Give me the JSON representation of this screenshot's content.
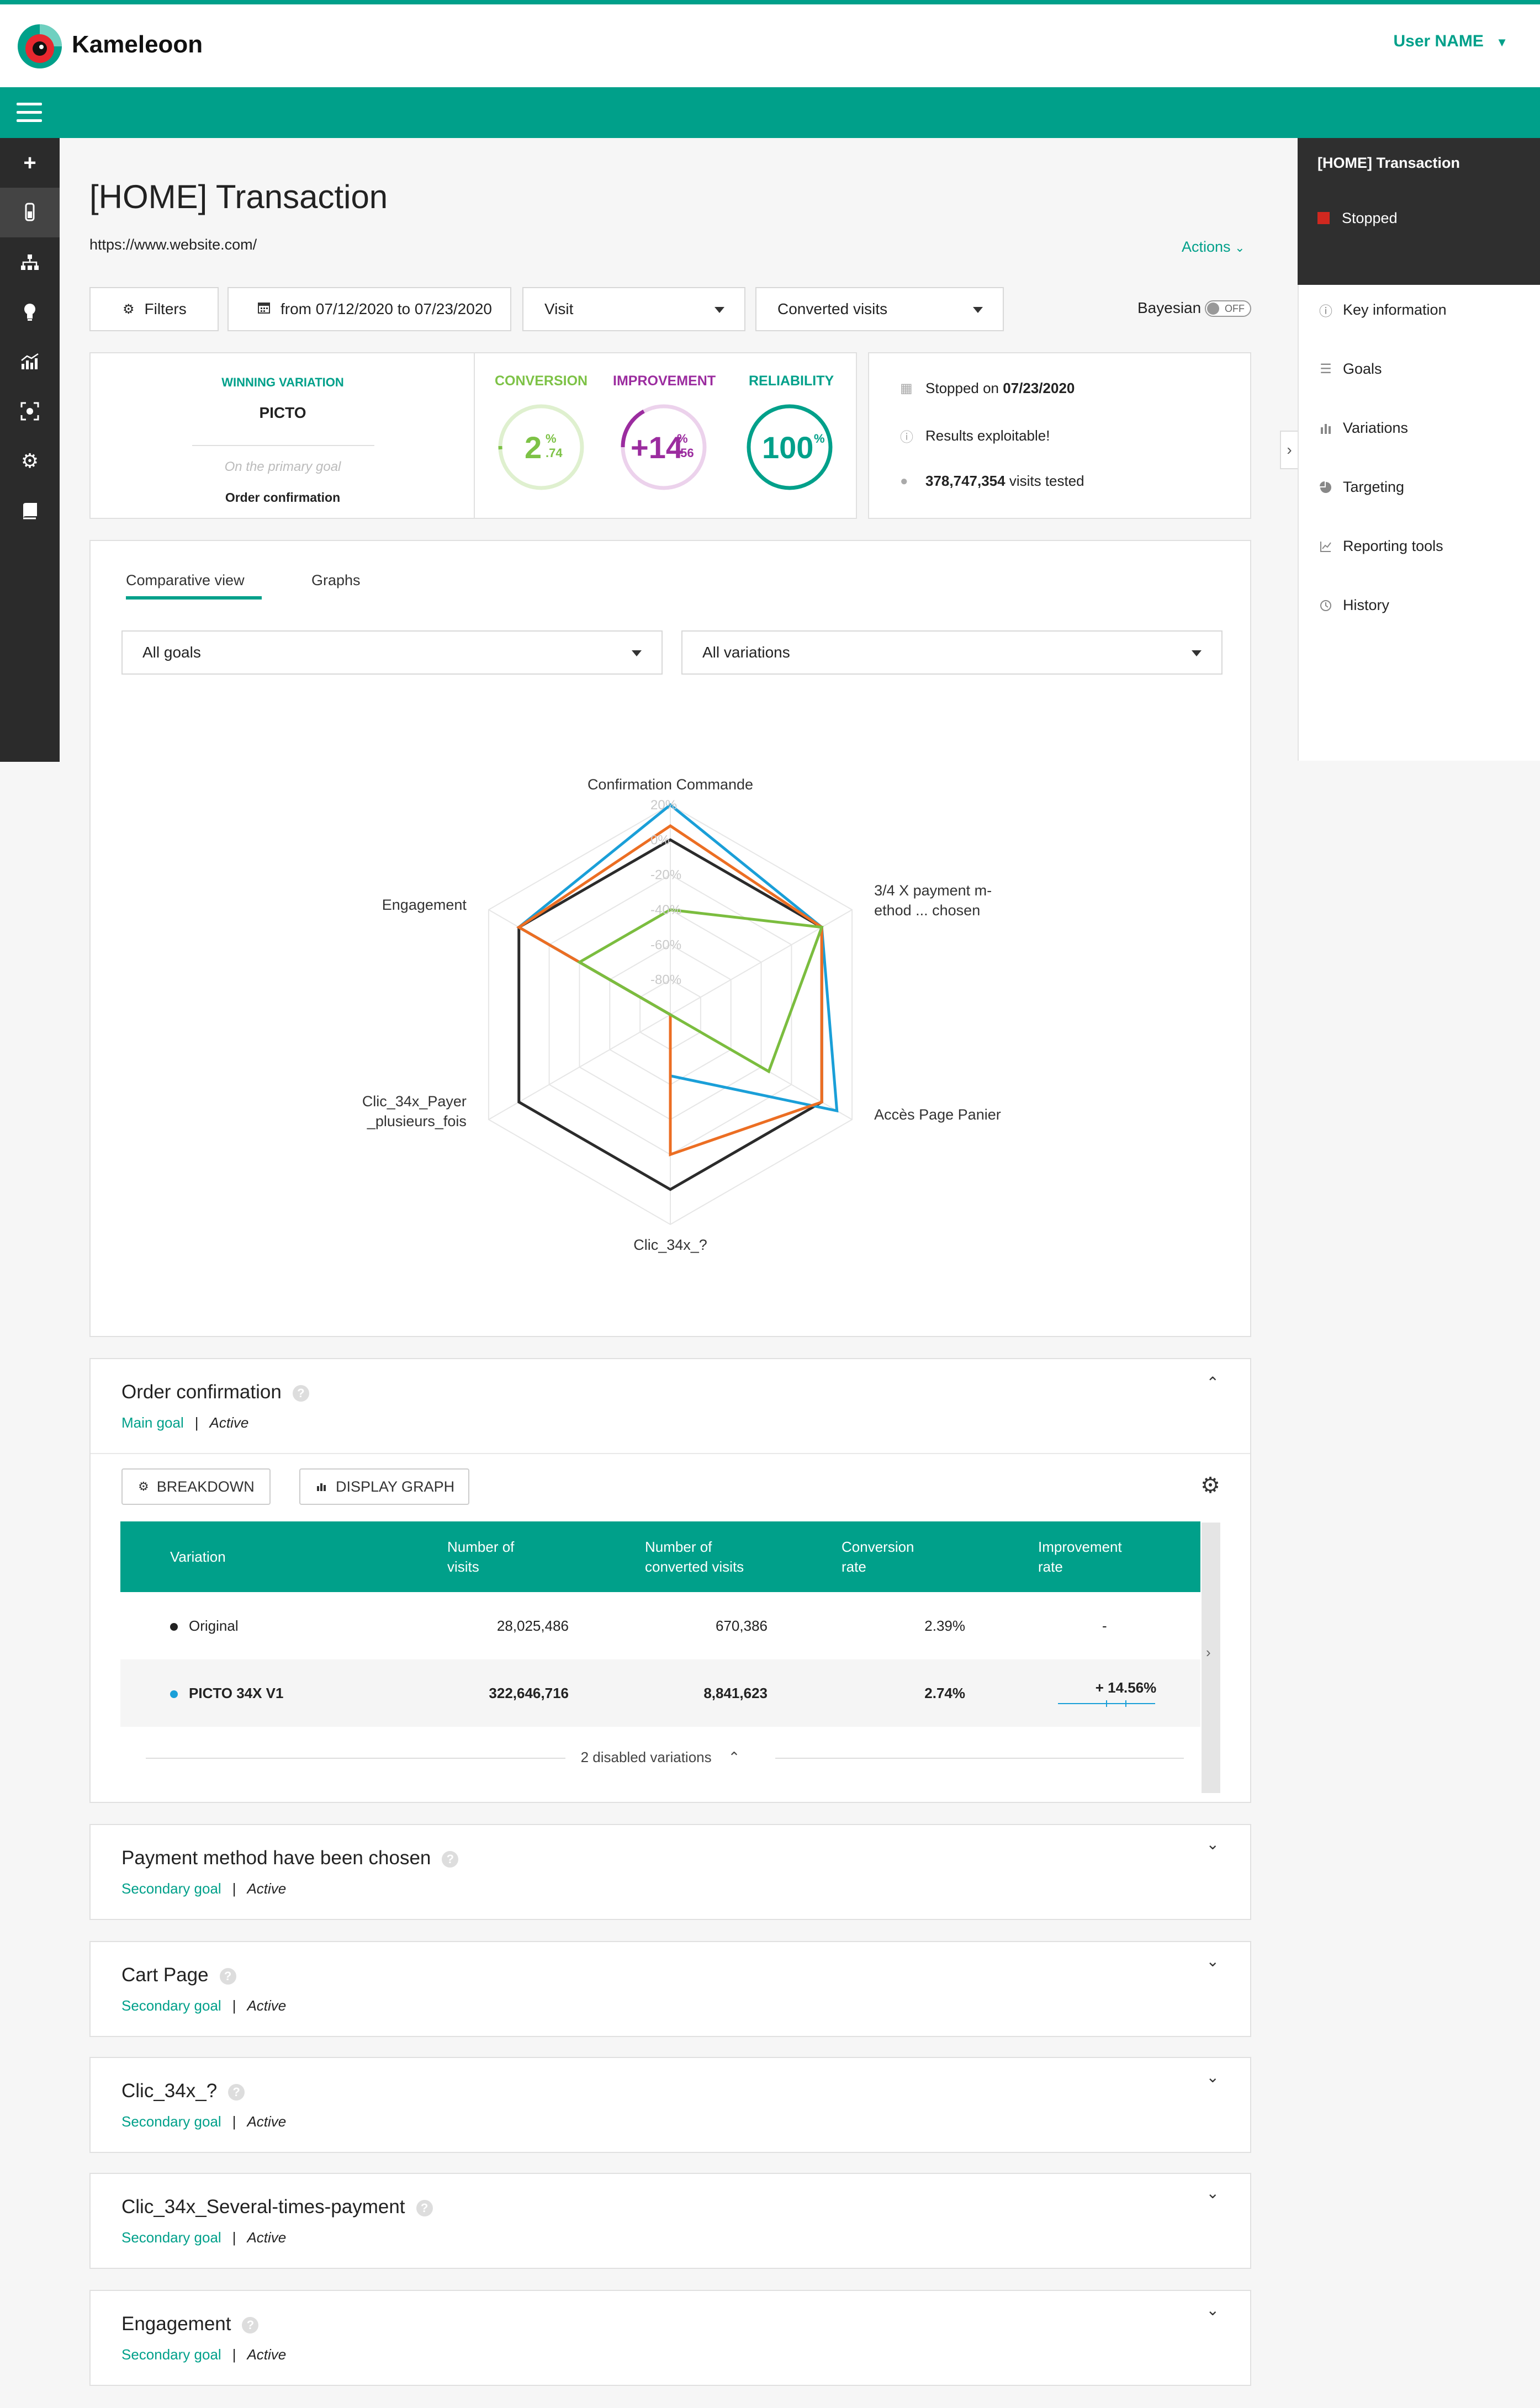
{
  "header": {
    "brand": "Kameleoon",
    "user": "User NAME"
  },
  "left_sidebar": {
    "items": [
      "plus-icon",
      "experiment-icon",
      "sitemap-icon",
      "lightbulb-icon",
      "chart-icon",
      "target-icon",
      "gear-icon",
      "book-icon"
    ]
  },
  "right_panel": {
    "title": "[HOME] Transaction",
    "status": "Stopped",
    "status_color": "#d0281f",
    "buttons": [
      "eye-icon",
      "pencil-icon",
      "trash-icon"
    ],
    "menu": [
      {
        "label": "Key information",
        "icon": "info-icon"
      },
      {
        "label": "Goals",
        "icon": "list-icon"
      },
      {
        "label": "Variations",
        "icon": "bars-icon"
      },
      {
        "label": "Targeting",
        "icon": "pie-icon"
      },
      {
        "label": "Reporting tools",
        "icon": "report-icon"
      },
      {
        "label": "History",
        "icon": "clock-icon"
      }
    ]
  },
  "page": {
    "title": "[HOME] Transaction",
    "url": "https://www.website.com/",
    "actions": "Actions"
  },
  "controls": {
    "filters": "Filters",
    "date_range": "from 07/12/2020 to 07/23/2020",
    "visit_select": "Visit",
    "converted_select": "Converted visits",
    "bayesian_label": "Bayesian",
    "bayesian_toggle": "OFF"
  },
  "summary": {
    "winning_label": "WINNING VARIATION",
    "winning_name": "PICTO",
    "primary_goal_note": "On the primary goal",
    "primary_goal": "Order confirmation",
    "conversion_label": "CONVERSION",
    "conversion_main": "2",
    "conversion_pct": "%",
    "conversion_dec": ".74",
    "conversion_color": "#7dc246",
    "improvement_label": "IMPROVEMENT",
    "improvement_main": "+14",
    "improvement_pct": "%",
    "improvement_dec": ".56",
    "improvement_color": "#9b2c9f",
    "reliability_label": "RELIABILITY",
    "reliability_main": "100",
    "reliability_pct": "%",
    "reliability_color": "#00a08a",
    "stopped_prefix": "Stopped on ",
    "stopped_date": "07/23/2020",
    "results": "Results exploitable!",
    "visits_count": "378,747,354",
    "visits_suffix": " visits tested"
  },
  "view_tabs": {
    "comparative": "Comparative view",
    "graphs": "Graphs"
  },
  "selects": {
    "goals": "All goals",
    "variations": "All variations"
  },
  "chart_data": {
    "type": "radar",
    "categories": [
      "Confirmation Commande",
      "3/4 X payment m-\nethod ... chosen",
      "Accès Page Panier",
      "Clic_34x_?",
      "Clic_34x_Payer\n_plusieurs_fois",
      "Engagement"
    ],
    "category_lines": [
      [
        "Confirmation Commande"
      ],
      [
        "3/4 X payment m-",
        "ethod ... chosen"
      ],
      [
        "Accès Page Panier"
      ],
      [
        "Clic_34x_?"
      ],
      [
        "Clic_34x_Payer",
        "_plusieurs_fois"
      ],
      [
        "Engagement"
      ]
    ],
    "axis_ticks": [
      "20%",
      "0%",
      "-20%",
      "-40%",
      "-60%",
      "-80%"
    ],
    "ylim": [
      -100,
      20
    ],
    "series": [
      {
        "color": "#2b2b2b",
        "values": [
          0,
          0,
          0,
          0,
          0,
          0
        ]
      },
      {
        "color": "#1a9fd8",
        "values": [
          20,
          0,
          10,
          -65,
          -100,
          0
        ]
      },
      {
        "color": "#ec6e23",
        "values": [
          8,
          0,
          0,
          -20,
          -100,
          0
        ]
      },
      {
        "color": "#7bbd3f",
        "values": [
          -40,
          0,
          -35,
          -100,
          -100,
          -40
        ]
      }
    ]
  },
  "goals": [
    {
      "title": "Order confirmation",
      "type": "Main goal",
      "status": "Active",
      "expanded": true
    },
    {
      "title": "Payment method have been chosen",
      "type": "Secondary goal",
      "status": "Active"
    },
    {
      "title": "Cart Page",
      "type": "Secondary goal",
      "status": "Active"
    },
    {
      "title": "Clic_34x_?",
      "type": "Secondary goal",
      "status": "Active"
    },
    {
      "title": "Clic_34x_Several-times-payment",
      "type": "Secondary goal",
      "status": "Active"
    },
    {
      "title": "Engagement",
      "type": "Secondary goal",
      "status": "Active"
    }
  ],
  "goal_separator": "|",
  "table": {
    "breakdown": "BREAKDOWN",
    "display_graph": "DISPLAY GRAPH",
    "headers": [
      "Variation",
      "Number of\nvisits",
      "Number of\nconverted visits",
      "Conversion\nrate",
      "Improvement\nrate"
    ],
    "header_lines": [
      [
        "Variation"
      ],
      [
        "Number of",
        "visits"
      ],
      [
        "Number of",
        "converted visits"
      ],
      [
        "Conversion",
        "rate"
      ],
      [
        "Improvement",
        "rate"
      ]
    ],
    "rows": [
      {
        "name": "Original",
        "visits": "28,025,486",
        "converted": "670,386",
        "rate": "2.39%",
        "improvement": "-",
        "dot": "#222222"
      },
      {
        "name": "PICTO 34X V1",
        "visits": "322,646,716",
        "converted": "8,841,623",
        "rate": "2.74%",
        "improvement": "+ 14.56%",
        "dot": "#1a9fd8"
      }
    ],
    "disabled": "2 disabled variations"
  }
}
